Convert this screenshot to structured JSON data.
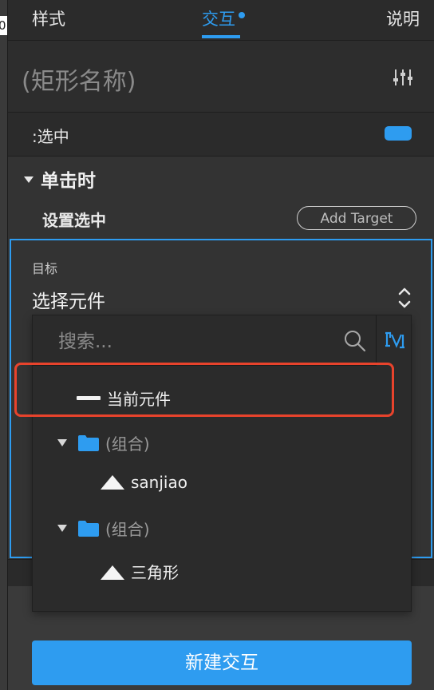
{
  "left_strip": {
    "cut_text": "0"
  },
  "tabs": [
    {
      "label": "样式",
      "active": false
    },
    {
      "label": "交互",
      "active": true
    },
    {
      "label": "说明",
      "active": false
    }
  ],
  "shape": {
    "name": "(矩形名称)"
  },
  "state_row": {
    "label": ":选中",
    "toggle_on": true
  },
  "event": {
    "title": "单击时",
    "action": "设置选中",
    "add_target_label": "Add Target"
  },
  "target": {
    "caption": "目标",
    "selected_value": "选择元件"
  },
  "dropdown": {
    "search_placeholder": "搜索...",
    "items": [
      {
        "label": "当前元件",
        "kind": "current"
      },
      {
        "label": "(组合)",
        "kind": "group"
      },
      {
        "label": "sanjiao",
        "kind": "triangle"
      },
      {
        "label": "(组合)",
        "kind": "group"
      },
      {
        "label": "三角形",
        "kind": "triangle"
      }
    ]
  },
  "new_interaction_label": "新建交互",
  "colors": {
    "accent": "#2e9cf0",
    "highlight": "#e8432c",
    "panel": "#333333"
  },
  "icons": [
    "sliders-icon",
    "search-icon",
    "filter-icon",
    "folder-icon",
    "triangle-icon",
    "chevron-updown-icon"
  ]
}
